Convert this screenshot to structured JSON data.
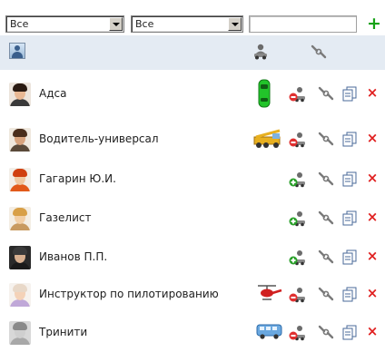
{
  "toolbar": {
    "filter1_value": "Все",
    "filter2_value": "Все",
    "search_value": "",
    "add_label": "+"
  },
  "rows": [
    {
      "name": "Адса",
      "vehicle": "green-car-icon",
      "status": "red"
    },
    {
      "name": "Водитель-универсал",
      "vehicle": "crane-truck-icon",
      "status": "red"
    },
    {
      "name": "Гагарин Ю.И.",
      "vehicle": "",
      "status": "green"
    },
    {
      "name": "Газелист",
      "vehicle": "",
      "status": "green"
    },
    {
      "name": "Иванов П.П.",
      "vehicle": "",
      "status": "green"
    },
    {
      "name": "Инструктор по пилотированию",
      "vehicle": "helicopter-icon",
      "status": "red"
    },
    {
      "name": "Тринити",
      "vehicle": "bus-icon",
      "status": "red"
    }
  ],
  "actions": {
    "delete_label": "×"
  },
  "colors": {
    "header_bg": "#e4ebf3",
    "add": "#16a216",
    "delete": "#e02020",
    "status_red": "#e03030",
    "status_green": "#2aa02a"
  }
}
